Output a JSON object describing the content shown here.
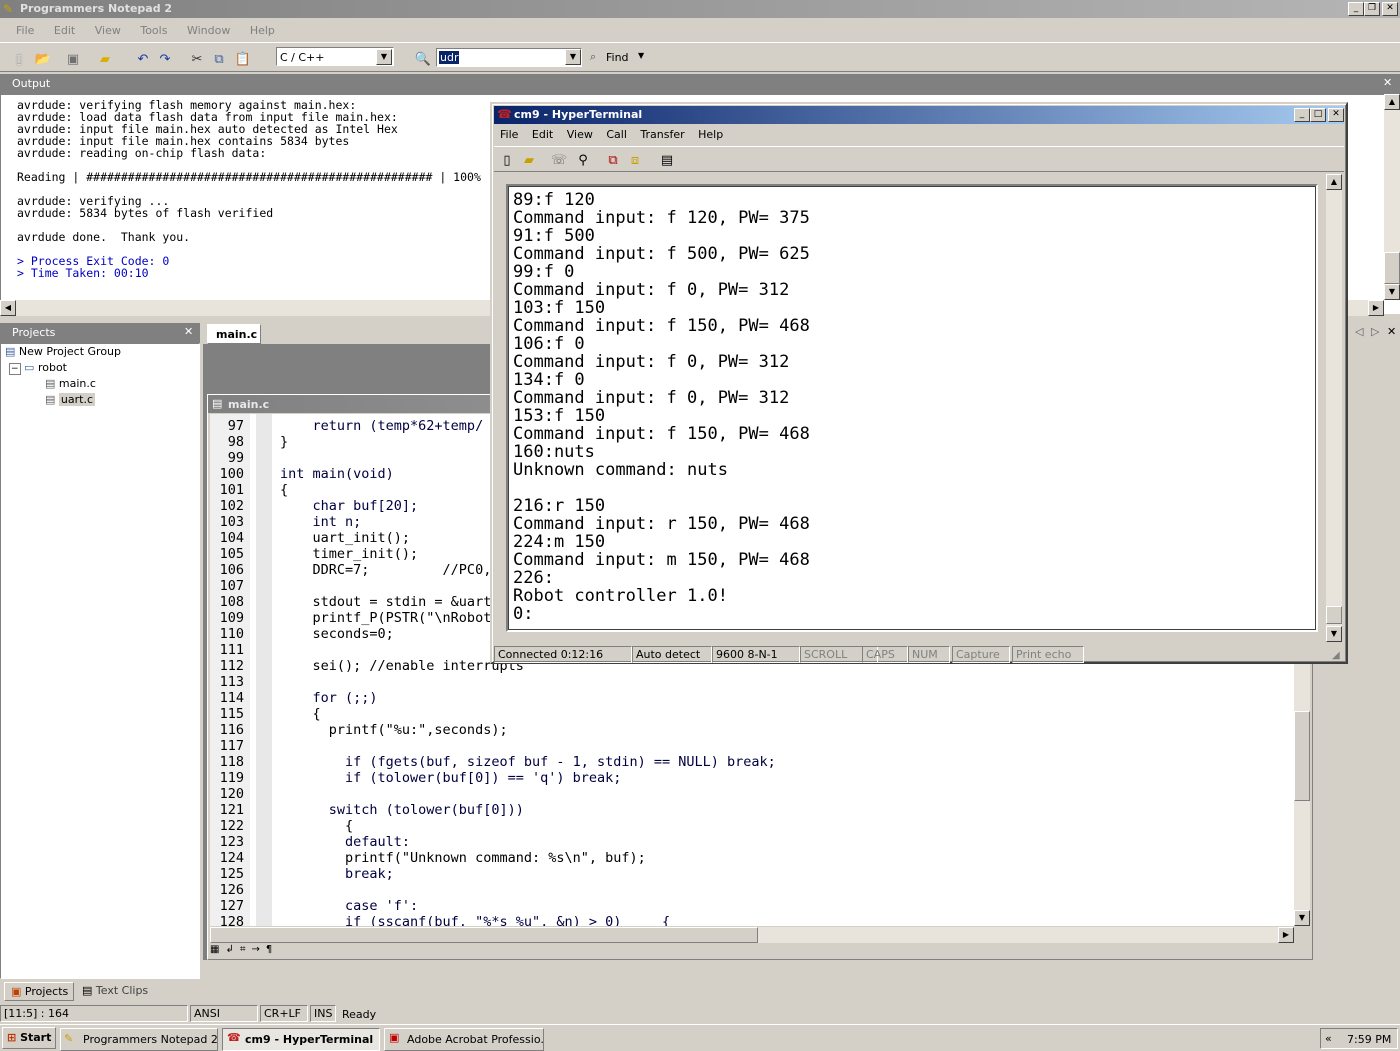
{
  "app": {
    "title": "Programmers Notepad 2",
    "menu": [
      "File",
      "Edit",
      "View",
      "Tools",
      "Window",
      "Help"
    ],
    "toolbar": {
      "language": "C / C++",
      "search_value": "udr",
      "find_label": "Find"
    }
  },
  "output": {
    "title": "Output",
    "lines": [
      "avrdude: verifying flash memory against main.hex:",
      "avrdude: load data flash data from input file main.hex:",
      "avrdude: input file main.hex auto detected as Intel Hex",
      "avrdude: input file main.hex contains 5834 bytes",
      "avrdude: reading on-chip flash data:",
      "",
      "Reading | ################################################## | 100%",
      "",
      "avrdude: verifying ...",
      "avrdude: 5834 bytes of flash verified",
      "",
      "avrdude done.  Thank you.",
      "",
      "> Process Exit Code: 0",
      "> Time Taken: 00:10"
    ]
  },
  "projects": {
    "title": "Projects",
    "group": "New Project Group",
    "project": "robot",
    "files": [
      "main.c",
      "uart.c"
    ],
    "tabs": [
      "Projects",
      "Text Clips"
    ]
  },
  "editor": {
    "tab": "main.c",
    "doc_title": "main.c",
    "lines": [
      {
        "n": "97",
        "t": "    return (temp*62+temp/"
      },
      {
        "n": "98",
        "t": "}"
      },
      {
        "n": "99",
        "t": ""
      },
      {
        "n": "100",
        "t": "int main(void)"
      },
      {
        "n": "101",
        "t": "{"
      },
      {
        "n": "102",
        "t": "    char buf[20];"
      },
      {
        "n": "103",
        "t": "    int n;"
      },
      {
        "n": "104",
        "t": "    uart_init();"
      },
      {
        "n": "105",
        "t": "    timer_init();"
      },
      {
        "n": "106",
        "t": "    DDRC=7;         //PC0,1"
      },
      {
        "n": "107",
        "t": ""
      },
      {
        "n": "108",
        "t": "    stdout = stdin = &uart_"
      },
      {
        "n": "109",
        "t": "    printf_P(PSTR(\"\\nRobot"
      },
      {
        "n": "110",
        "t": "    seconds=0;"
      },
      {
        "n": "111",
        "t": ""
      },
      {
        "n": "112",
        "t": "    sei(); //enable interrupts"
      },
      {
        "n": "113",
        "t": ""
      },
      {
        "n": "114",
        "t": "    for (;;)"
      },
      {
        "n": "115",
        "t": "    {"
      },
      {
        "n": "116",
        "t": "      printf(\"%u:\",seconds);"
      },
      {
        "n": "117",
        "t": ""
      },
      {
        "n": "118",
        "t": "        if (fgets(buf, sizeof buf - 1, stdin) == NULL) break;"
      },
      {
        "n": "119",
        "t": "        if (tolower(buf[0]) == 'q') break;"
      },
      {
        "n": "120",
        "t": ""
      },
      {
        "n": "121",
        "t": "      switch (tolower(buf[0]))"
      },
      {
        "n": "122",
        "t": "        {"
      },
      {
        "n": "123",
        "t": "        default:"
      },
      {
        "n": "124",
        "t": "        printf(\"Unknown command: %s\\n\", buf);"
      },
      {
        "n": "125",
        "t": "        break;"
      },
      {
        "n": "126",
        "t": ""
      },
      {
        "n": "127",
        "t": "        case 'f':"
      },
      {
        "n": "128",
        "t": "        if (sscanf(buf, \"%*s %u\", &n) > 0)     {"
      }
    ]
  },
  "status": {
    "position": "[11:5] : 164",
    "encoding": "ANSI",
    "line_ending": "CR+LF",
    "mode": "INS",
    "state": "Ready"
  },
  "hyperterminal": {
    "title": "cm9 - HyperTerminal",
    "menu": [
      "File",
      "Edit",
      "View",
      "Call",
      "Transfer",
      "Help"
    ],
    "lines": [
      "89:f 120",
      "Command input: f 120, PW= 375",
      "91:f 500",
      "Command input: f 500, PW= 625",
      "99:f 0",
      "Command input: f 0, PW= 312",
      "103:f 150",
      "Command input: f 150, PW= 468",
      "106:f 0",
      "Command input: f 0, PW= 312",
      "134:f 0",
      "Command input: f 0, PW= 312",
      "153:f 150",
      "Command input: f 150, PW= 468",
      "160:nuts",
      "Unknown command: nuts",
      "",
      "216:r 150",
      "Command input: r 150, PW= 468",
      "224:m 150",
      "Command input: m 150, PW= 468",
      "226:",
      "Robot controller 1.0!",
      "0:"
    ],
    "status": {
      "connected": "Connected 0:12:16",
      "detect": "Auto detect",
      "settings": "9600 8-N-1",
      "scroll": "SCROLL",
      "caps": "CAPS",
      "num": "NUM",
      "capture": "Capture",
      "print_echo": "Print echo"
    }
  },
  "taskbar": {
    "start": "Start",
    "items": [
      "Programmers Notepad 2",
      "cm9 - HyperTerminal",
      "Adobe Acrobat Professio..."
    ],
    "clock": "7:59 PM"
  }
}
